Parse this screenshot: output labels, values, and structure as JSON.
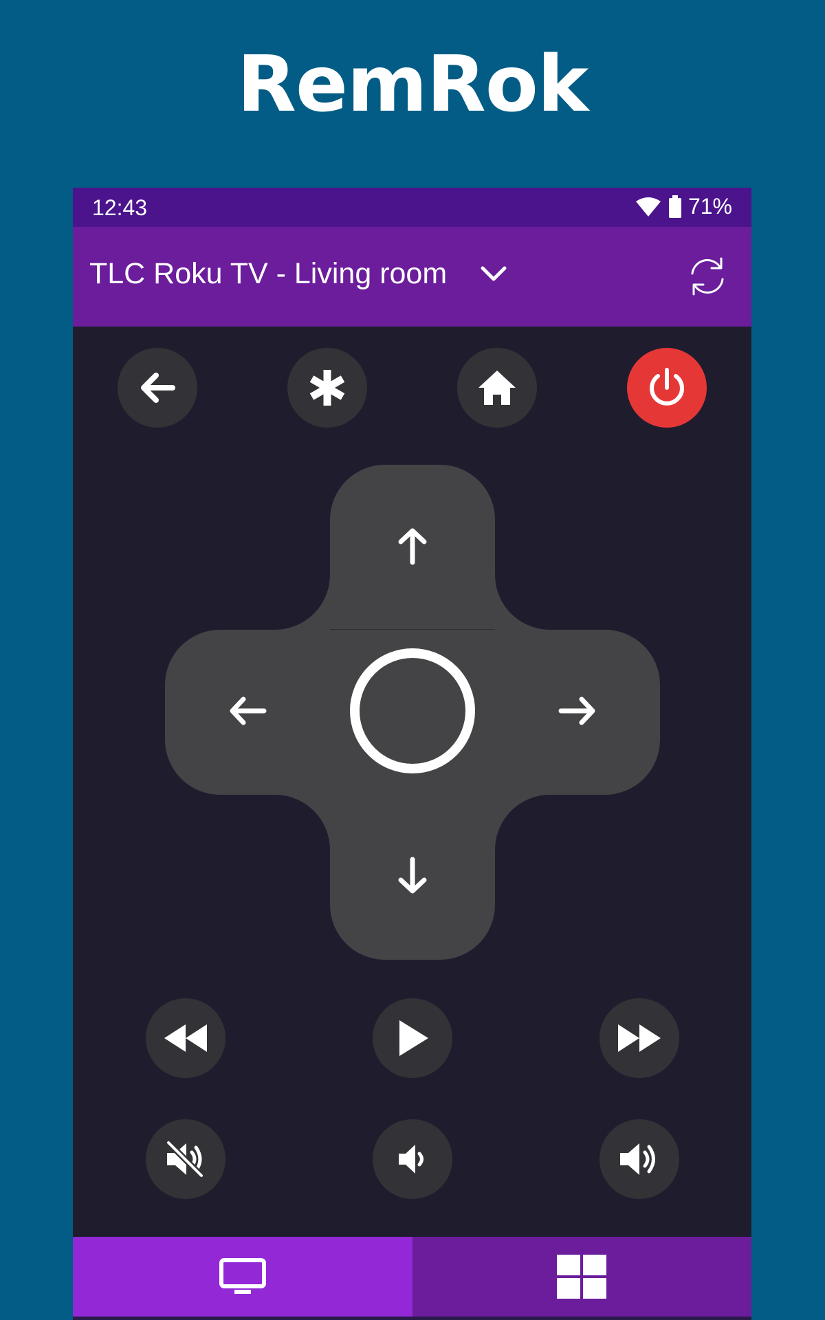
{
  "promo": {
    "title": "RemRok"
  },
  "status_bar": {
    "time": "12:43",
    "battery_percent": "71%",
    "icons": [
      "wifi-icon",
      "battery-icon"
    ]
  },
  "app_bar": {
    "device_name": "TLC Roku TV - Living room",
    "icons": [
      "chevron-down-icon",
      "refresh-icon"
    ]
  },
  "remote": {
    "top_buttons": [
      "back-arrow-icon",
      "asterisk-icon",
      "home-icon",
      "power-icon"
    ],
    "dpad": [
      "up-arrow-icon",
      "left-arrow-icon",
      "ok-circle-icon",
      "right-arrow-icon",
      "down-arrow-icon"
    ],
    "media_buttons": [
      "rewind-icon",
      "play-icon",
      "fast-forward-icon"
    ],
    "volume_buttons": [
      "mute-icon",
      "volume-down-icon",
      "volume-up-icon"
    ]
  },
  "bottom_nav": {
    "tabs": [
      "tv-icon",
      "grid-icon"
    ],
    "selected": 0
  },
  "colors": {
    "page_background": "#025c85",
    "status_bar": "#4b148c",
    "app_bar": "#6b1d9c",
    "remote_background": "#1f1d2d",
    "button": "#333236",
    "dpad": "#444446",
    "power": "#e63737",
    "nav_selected": "#9228d6"
  }
}
